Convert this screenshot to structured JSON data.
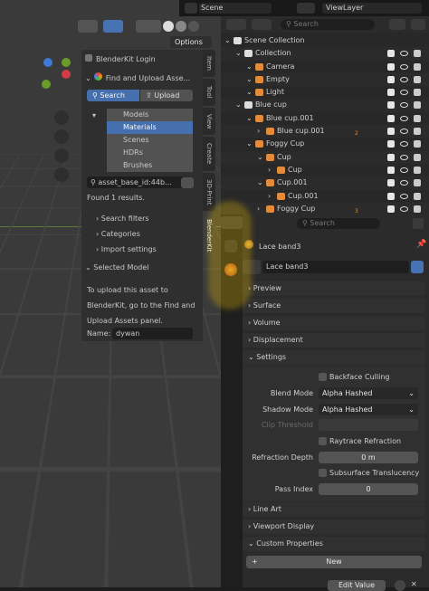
{
  "viewport": {
    "options_label": "Options"
  },
  "blenderkit": {
    "login": "BlenderKit Login",
    "find_upload": "Find and Upload Asse...",
    "search_btn": "Search",
    "upload_btn": "Upload",
    "asset_types": [
      "Models",
      "Materials",
      "Scenes",
      "HDRs",
      "Brushes"
    ],
    "selected_type": "Materials",
    "search_value": "asset_base_id:44b...",
    "found": "Found 1 results.",
    "filters": "Search filters",
    "categories": "Categories",
    "import_settings": "Import settings",
    "selected_model": "Selected Model",
    "upload_msg": [
      "To upload this asset to",
      "BlenderKit, go to the Find and",
      "Upload Assets panel."
    ],
    "name_label": "Name:",
    "name_value": "dywan"
  },
  "side_tabs": [
    "Item",
    "Tool",
    "View",
    "Create",
    "3D-Print",
    "BlenderKit"
  ],
  "topbar": {
    "scene": "Scene",
    "viewlayer": "ViewLayer",
    "search_placeholder": "Search"
  },
  "outliner": {
    "items": [
      {
        "label": "Scene Collection",
        "indent": 0
      },
      {
        "label": "Collection",
        "indent": 1
      },
      {
        "label": "Camera",
        "indent": 2
      },
      {
        "label": "Empty",
        "indent": 2
      },
      {
        "label": "Light",
        "indent": 2
      },
      {
        "label": "Blue cup",
        "indent": 1
      },
      {
        "label": "Blue cup.001",
        "indent": 2
      },
      {
        "label": "Blue cup.001",
        "indent": 3,
        "badge": "2"
      },
      {
        "label": "Foggy Cup",
        "indent": 2
      },
      {
        "label": "Cup",
        "indent": 3
      },
      {
        "label": "Cup",
        "indent": 4
      },
      {
        "label": "Cup.001",
        "indent": 3
      },
      {
        "label": "Cup.001",
        "indent": 4
      },
      {
        "label": "Foggy Cup",
        "indent": 3,
        "badge": "3"
      }
    ]
  },
  "properties": {
    "search_placeholder": "Search",
    "material_path": "Lace band3",
    "material_name": "Lace band3",
    "sections_top": [
      "Preview",
      "Surface",
      "Volume",
      "Displacement"
    ],
    "settings_title": "Settings",
    "backface": "Backface Culling",
    "blend_mode_label": "Blend Mode",
    "blend_mode": "Alpha Hashed",
    "shadow_mode_label": "Shadow Mode",
    "shadow_mode": "Alpha Hashed",
    "clip_label": "Clip Threshold",
    "raytrace": "Raytrace Refraction",
    "refraction_label": "Refraction Depth",
    "refraction_value": "0 m",
    "subsurface": "Subsurface Translucency",
    "pass_label": "Pass Index",
    "pass_value": "0",
    "sections_bottom": [
      "Line Art",
      "Viewport Display"
    ],
    "custom_props": "Custom Properties",
    "new_btn": "New",
    "edit_value": "Edit Value"
  },
  "colors": {
    "accent": "#4772b3",
    "highlight": "#f5c400"
  }
}
